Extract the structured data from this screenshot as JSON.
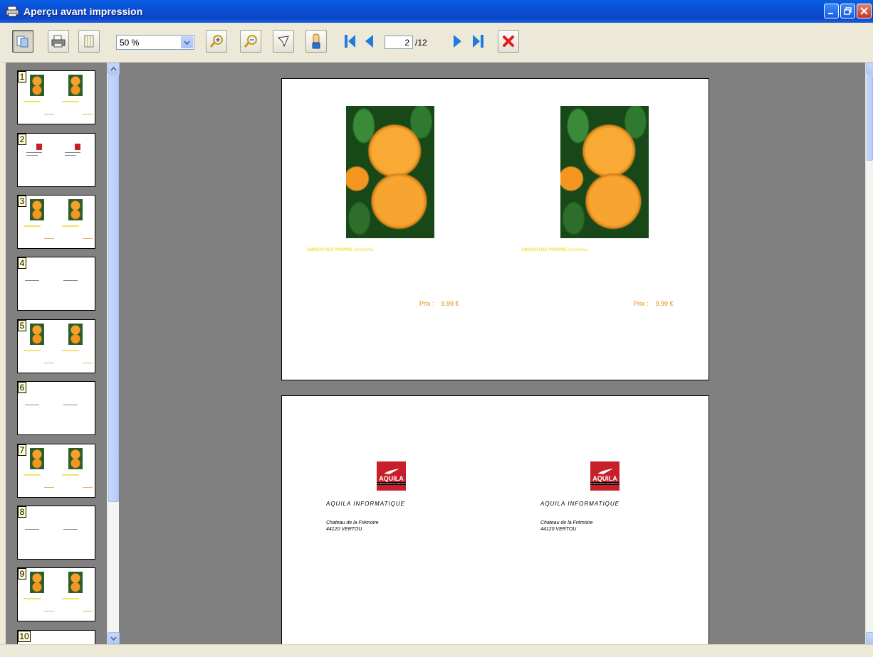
{
  "window": {
    "title": "Aperçu avant impression"
  },
  "toolbar": {
    "zoom_value": "50 %",
    "current_page": "2",
    "total_pages": "/12"
  },
  "thumbnails": [
    {
      "num": "1",
      "kind": "fruit"
    },
    {
      "num": "2",
      "kind": "logo"
    },
    {
      "num": "3",
      "kind": "fruit"
    },
    {
      "num": "4",
      "kind": "text"
    },
    {
      "num": "5",
      "kind": "fruit"
    },
    {
      "num": "6",
      "kind": "text"
    },
    {
      "num": "7",
      "kind": "fruit"
    },
    {
      "num": "8",
      "kind": "text"
    },
    {
      "num": "9",
      "kind": "fruit"
    },
    {
      "num": "10",
      "kind": "blank"
    }
  ],
  "page_one": {
    "items": [
      {
        "label": "ABRICOTIER PROPRE",
        "label_small": "aliment/ou",
        "price_label": "Prix :",
        "price": "9.99 €"
      },
      {
        "label": "ABRICOTIER PROPRE",
        "label_small": "aliment/ou",
        "price_label": "Prix :",
        "price": "9.99 €"
      }
    ]
  },
  "page_two": {
    "cards": [
      {
        "logo": "AQUILA",
        "logo_sub": "INTÉGRATEUR DE GESTION",
        "company": "AQUILA INFORMATIQUE",
        "addr1": "Chateau de la Frémoire",
        "addr2": "44120 VERTOU"
      },
      {
        "logo": "AQUILA",
        "logo_sub": "INTÉGRATEUR DE GESTION",
        "company": "AQUILA INFORMATIQUE",
        "addr1": "Chateau de la Frémoire",
        "addr2": "44120 VERTOU"
      }
    ]
  },
  "colors": {
    "titlebar": "#0a4fd4",
    "background": "#808080",
    "label_yellow": "#f2e040",
    "price_orange": "#e08a10",
    "logo_red": "#c8202a"
  }
}
